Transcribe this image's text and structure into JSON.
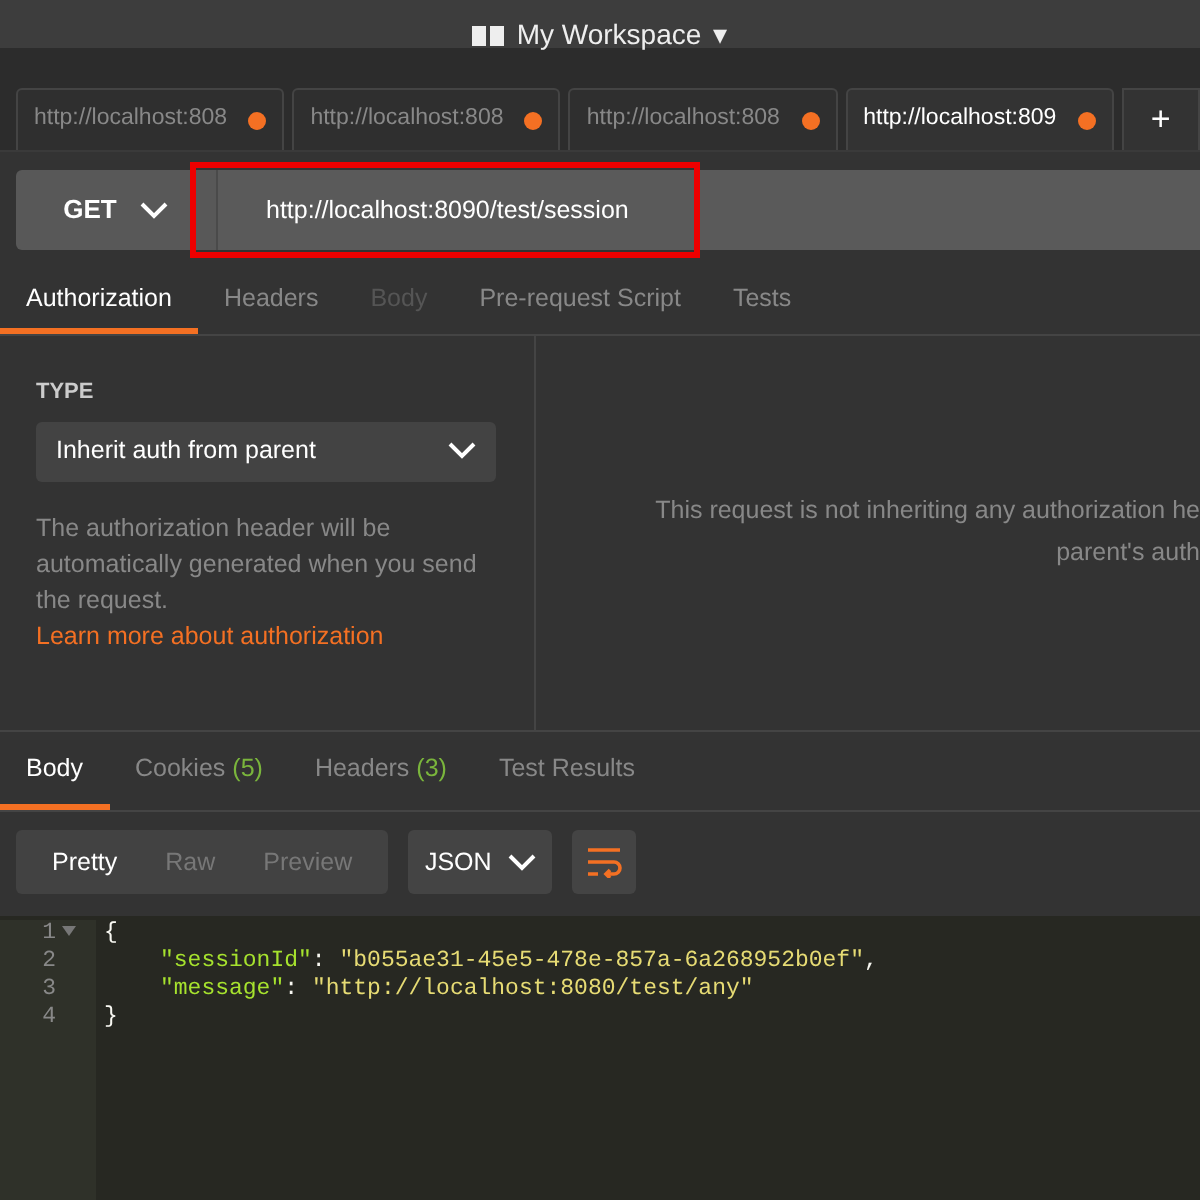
{
  "header": {
    "workspace": "My Workspace",
    "caret": "▾"
  },
  "request_tabs": [
    {
      "label": "http://localhost:808",
      "selected": false,
      "unsaved": true
    },
    {
      "label": "http://localhost:808",
      "selected": false,
      "unsaved": true
    },
    {
      "label": "http://localhost:808",
      "selected": false,
      "unsaved": true
    },
    {
      "label": "http://localhost:809",
      "selected": true,
      "unsaved": true
    }
  ],
  "new_tab": "+",
  "request": {
    "method": "GET",
    "url": "http://localhost:8090/test/session",
    "highlighted": true
  },
  "section_tabs": [
    {
      "label": "Authorization",
      "selected": true,
      "disabled": false
    },
    {
      "label": "Headers",
      "selected": false,
      "disabled": false
    },
    {
      "label": "Body",
      "selected": false,
      "disabled": true
    },
    {
      "label": "Pre-request Script",
      "selected": false,
      "disabled": false
    },
    {
      "label": "Tests",
      "selected": false,
      "disabled": false
    }
  ],
  "auth": {
    "type_label": "TYPE",
    "type_value": "Inherit auth from parent",
    "description": "The authorization header will be automatically generated when you send the request.",
    "link": "Learn more about authorization",
    "message_lines": [
      "This request is not inheriting any authorization he",
      "parent's auth"
    ]
  },
  "response_tabs": [
    {
      "label": "Body",
      "selected": true
    },
    {
      "label": "Cookies",
      "count": "(5)",
      "selected": false
    },
    {
      "label": "Headers",
      "count": "(3)",
      "selected": false
    },
    {
      "label": "Test Results",
      "selected": false
    }
  ],
  "view_modes": [
    {
      "label": "Pretty",
      "selected": true
    },
    {
      "label": "Raw",
      "selected": false
    },
    {
      "label": "Preview",
      "selected": false
    }
  ],
  "format": "JSON",
  "code": [
    {
      "number": "1",
      "foldable": true,
      "tokens": [
        {
          "kind": "punct",
          "text": "{"
        }
      ]
    },
    {
      "number": "2",
      "indented": true,
      "tokens": [
        {
          "kind": "key",
          "text": "\"sessionId\""
        },
        {
          "kind": "punct",
          "text": ": "
        },
        {
          "kind": "string",
          "text": "\"b055ae31-45e5-478e-857a-6a268952b0ef\""
        },
        {
          "kind": "punct",
          "text": ","
        }
      ]
    },
    {
      "number": "3",
      "indented": true,
      "tokens": [
        {
          "kind": "key",
          "text": "\"message\""
        },
        {
          "kind": "punct",
          "text": ": "
        },
        {
          "kind": "string",
          "text": "\"http://localhost:8080/test/any\""
        }
      ]
    },
    {
      "number": "4",
      "tokens": [
        {
          "kind": "punct",
          "text": "}"
        }
      ]
    }
  ]
}
